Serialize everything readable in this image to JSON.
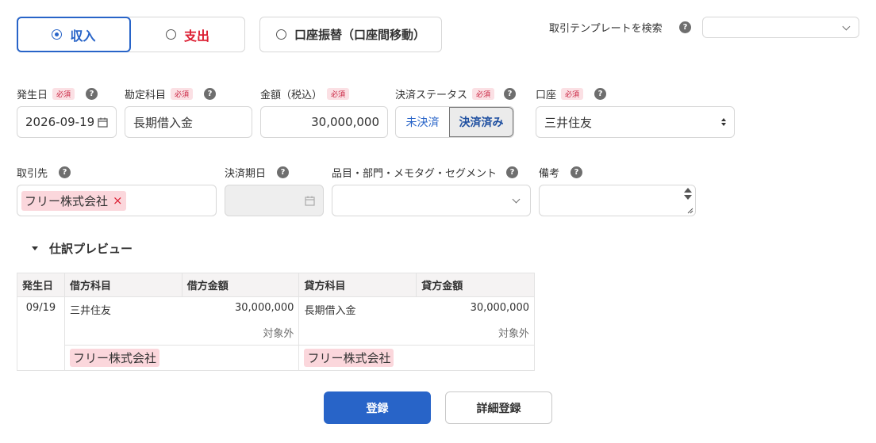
{
  "type_selector": {
    "income_label": "収入",
    "expense_label": "支出",
    "transfer_label": "口座振替（口座間移動）"
  },
  "template_search": {
    "label": "取引テンプレートを検索",
    "value": ""
  },
  "help_glyph": "?",
  "required_badge": "必須",
  "fields": {
    "date": {
      "label": "発生日",
      "value": "2026-09-19"
    },
    "account_item": {
      "label": "勘定科目",
      "value": "長期借入金"
    },
    "amount": {
      "label": "金額（税込）",
      "value": "30,000,000"
    },
    "settlement": {
      "label": "決済ステータス",
      "unsettled": "未決済",
      "settled": "決済済み"
    },
    "wallet": {
      "label": "口座",
      "value": "三井住友"
    },
    "partner": {
      "label": "取引先",
      "tag": "フリー株式会社",
      "remove_glyph": "×"
    },
    "due_date": {
      "label": "決済期日"
    },
    "segments": {
      "label": "品目・部門・メモタグ・セグメント"
    },
    "note": {
      "label": "備考",
      "value": ""
    }
  },
  "preview": {
    "title": "仕訳プレビュー",
    "headers": {
      "date": "発生日",
      "debit_item": "借方科目",
      "debit_amount": "借方金額",
      "credit_item": "貸方科目",
      "credit_amount": "貸方金額"
    },
    "row": {
      "date": "09/19",
      "debit_item": "三井住友",
      "debit_amount": "30,000,000",
      "debit_tax": "対象外",
      "debit_partner": "フリー株式会社",
      "credit_item": "長期借入金",
      "credit_amount": "30,000,000",
      "credit_tax": "対象外",
      "credit_partner": "フリー株式会社"
    }
  },
  "actions": {
    "register": "登録",
    "detail_register": "詳細登録"
  },
  "colors": {
    "accent": "#2864c8",
    "expense": "#dc1e32",
    "tag_bg": "#fbd7dc"
  }
}
